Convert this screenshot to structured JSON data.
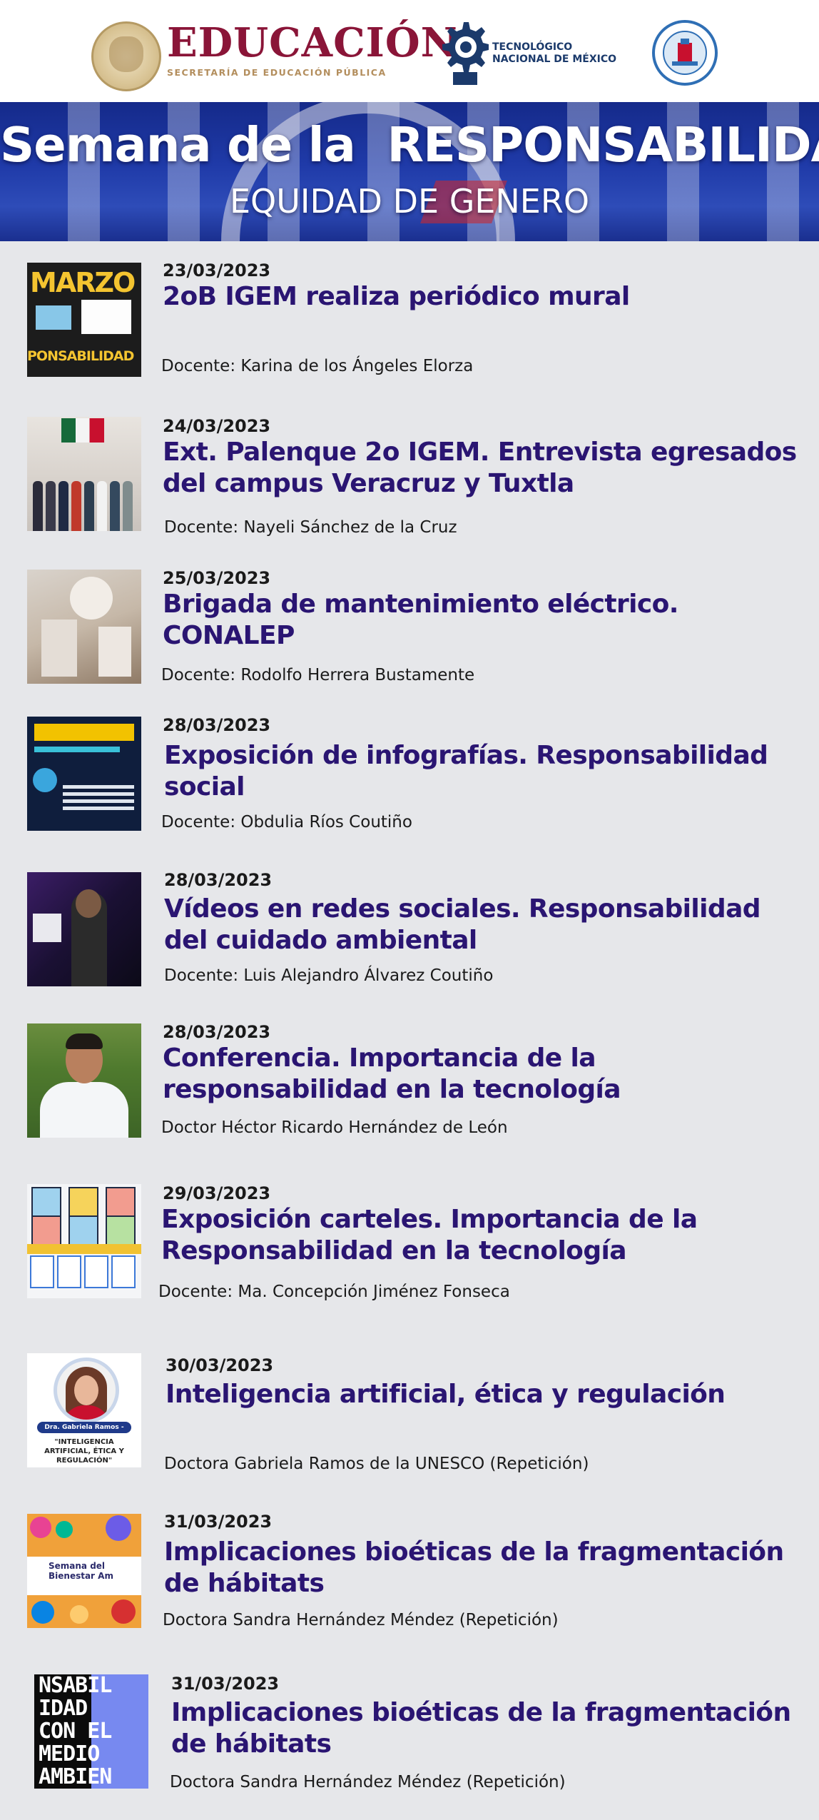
{
  "header": {
    "edu_title": "EDUCACIÓN",
    "edu_subtitle": "SECRETARÍA DE EDUCACIÓN PÚBLICA",
    "tecnm_line1": "TECNOLÓGICO",
    "tecnm_line2": "NACIONAL DE MÉXICO",
    "logos": [
      "mexico-seal-icon",
      "tecnm-gear-icon",
      "tec-tuxtla-logo-icon"
    ]
  },
  "banner": {
    "title": "Semana de la  RESPONSABILIDAD",
    "subtitle": "EQUIDAD DE GENERO"
  },
  "colors": {
    "title_purple": "#2a1572",
    "background": "#e6e7ea",
    "edu_red": "#8a1538",
    "edu_gold": "#b38e5d",
    "banner_blue": "#1f3aa8"
  },
  "entries": [
    {
      "date": "23/03/2023",
      "title": "2oB IGEM realiza periódico mural",
      "docente": "Docente: Karina de los Ángeles Elorza",
      "thumb_text_1": "MARZO",
      "thumb_text_2": "PONSABILIDAD"
    },
    {
      "date": "24/03/2023",
      "title": "Ext. Palenque 2o IGEM. Entrevista egresados del campus Veracruz y Tuxtla",
      "docente": "Docente: Nayeli Sánchez de la Cruz"
    },
    {
      "date": "25/03/2023",
      "title": "Brigada de mantenimiento eléctrico. CONALEP",
      "docente": "Docente: Rodolfo Herrera Bustamente"
    },
    {
      "date": "28/03/2023",
      "title": "Exposición de infografías. Responsabilidad social",
      "docente": "Docente: Obdulia Ríos Coutiño"
    },
    {
      "date": "28/03/2023",
      "title": "Vídeos en redes sociales. Responsabilidad del cuidado ambiental",
      "docente": "Docente: Luis Alejandro Álvarez Coutiño"
    },
    {
      "date": "28/03/2023",
      "title": "Conferencia. Importancia de la responsabilidad en la tecnología",
      "docente": "Doctor Héctor Ricardo Hernández de León"
    },
    {
      "date": "29/03/2023",
      "title": "Exposición carteles. Importancia de la Responsabilidad en la tecnología",
      "docente": "Docente: Ma. Concepción Jiménez Fonseca"
    },
    {
      "date": "30/03/2023",
      "title": "Inteligencia artificial, ética y regulación",
      "docente": "Doctora Gabriela Ramos de la UNESCO (Repetición)",
      "thumb_pill": "Dra. Gabriela Ramos - UNESCO",
      "thumb_caption": "\"INTELIGENCIA ARTIFICIAL, ÉTICA Y REGULACIÓN\""
    },
    {
      "date": "31/03/2023",
      "title": "Implicaciones bioéticas de la fragmentación de hábitats",
      "docente": "Doctora Sandra Hernández Méndez (Repetición)",
      "thumb_text": "Semana del Bienestar Am"
    },
    {
      "date": "31/03/2023",
      "title": "Implicaciones bioéticas de la fragmentación de hábitats",
      "docente": "Doctora Sandra Hernández Méndez (Repetición)",
      "thumb_text": "NSABIL\nIDAD\nCON EL\nMEDIO\nAMBIEN\nTE"
    }
  ]
}
